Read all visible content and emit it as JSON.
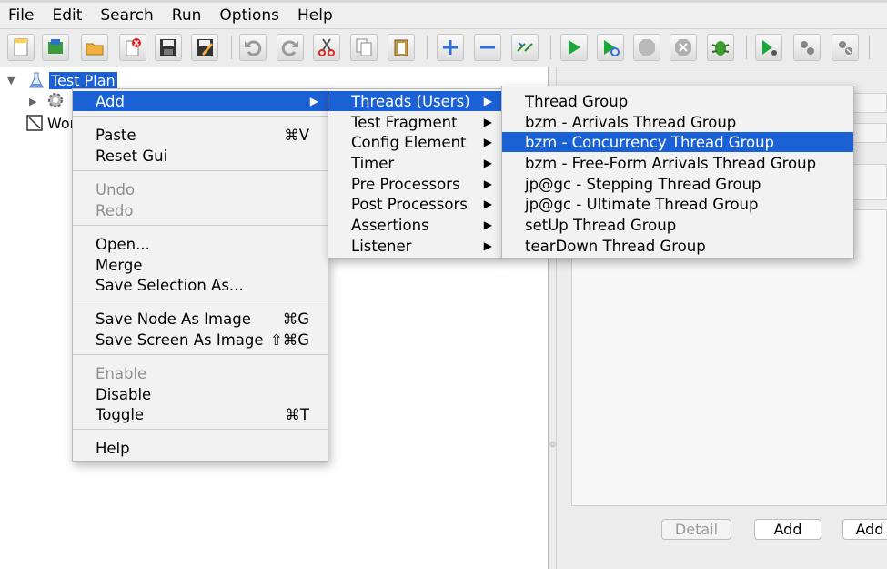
{
  "menubar": [
    "File",
    "Edit",
    "Search",
    "Run",
    "Options",
    "Help"
  ],
  "toolbar_icons": [
    "new-icon",
    "templates-icon",
    "open-icon",
    "close-icon",
    "save-icon",
    "save-as-icon",
    "undo-icon",
    "redo-icon",
    "cut-icon",
    "copy-icon",
    "paste-icon",
    "expand-icon",
    "collapse-icon",
    "toggle-icon",
    "start-icon",
    "start-no-pauses-icon",
    "stop-icon",
    "shutdown-icon",
    "clear-bug-icon",
    "remote-start-icon",
    "remote-stop-icon",
    "remote-shutdown-icon"
  ],
  "tree": {
    "root_label": "Test Plan",
    "workbench_label": "Wor"
  },
  "context_menu": {
    "add": "Add",
    "items": [
      {
        "label": "Paste",
        "shortcut": "⌘V"
      },
      {
        "label": "Reset Gui",
        "shortcut": ""
      },
      {
        "label": "Undo",
        "shortcut": ""
      },
      {
        "label": "Redo",
        "shortcut": ""
      },
      {
        "label": "Open...",
        "shortcut": ""
      },
      {
        "label": "Merge",
        "shortcut": ""
      },
      {
        "label": "Save Selection As...",
        "shortcut": ""
      },
      {
        "label": "Save Node As Image",
        "shortcut": "⌘G"
      },
      {
        "label": "Save Screen As Image",
        "shortcut": "⇧⌘G"
      },
      {
        "label": "Enable",
        "shortcut": ""
      },
      {
        "label": "Disable",
        "shortcut": ""
      },
      {
        "label": "Toggle",
        "shortcut": "⌘T"
      },
      {
        "label": "Help",
        "shortcut": ""
      }
    ]
  },
  "add_submenu": [
    "Threads (Users)",
    "Test Fragment",
    "Config Element",
    "Timer",
    "Pre Processors",
    "Post Processors",
    "Assertions",
    "Listener"
  ],
  "threads_submenu": [
    "Thread Group",
    "bzm - Arrivals Thread Group",
    "bzm - Concurrency Thread Group",
    "bzm - Free-Form Arrivals Thread Group",
    "jp@gc - Stepping Thread Group",
    "jp@gc - Ultimate Thread Group",
    "setUp Thread Group",
    "tearDown Thread Group"
  ],
  "buttons": {
    "detail": "Detail",
    "add": "Add",
    "add2": "Add"
  },
  "colors": {
    "selection": "#1a61d6"
  }
}
